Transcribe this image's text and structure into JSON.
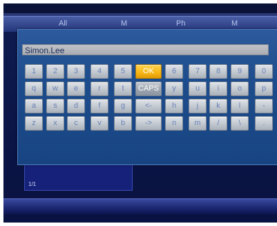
{
  "background": {
    "tabs": [
      "All",
      "M",
      "Ph",
      "M"
    ],
    "page_indicator": "1/1"
  },
  "keyboard": {
    "input_value": "Simon.Lee",
    "rows": [
      [
        "1",
        "2",
        "3",
        "4",
        "5",
        "OK",
        "6",
        "7",
        "8",
        "9",
        "0"
      ],
      [
        "q",
        "w",
        "e",
        "r",
        "t",
        "CAPS",
        "y",
        "u",
        "i",
        "o",
        "p"
      ],
      [
        "a",
        "s",
        "d",
        "f",
        "g",
        "<-",
        "h",
        "j",
        "k",
        "l",
        "-"
      ],
      [
        "z",
        "x",
        "c",
        "v",
        "b",
        "->",
        "n",
        "m",
        "/",
        "\\",
        "."
      ]
    ],
    "selected_key": "OK"
  },
  "colors": {
    "dialog_bg": "#1d4c8c",
    "key_bg": "#c2c8cf",
    "key_selected": "#f7b515",
    "screen_bg": "#0e1a4e"
  }
}
